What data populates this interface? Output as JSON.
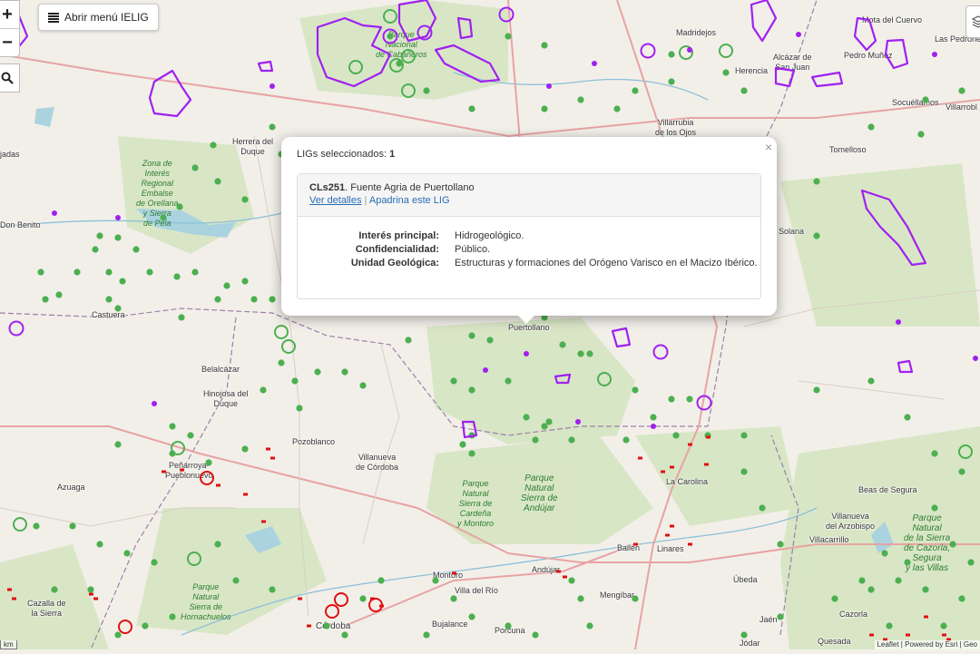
{
  "toolbar": {
    "zoom_in": "+",
    "zoom_out": "−",
    "menu_label": "Abrir menú IELIG"
  },
  "popup": {
    "selected_label": "LIGs seleccionados:",
    "selected_count": "1",
    "close": "×",
    "lig_code": "CLs251",
    "lig_name": ". Fuente Agria de Puertollano",
    "details_link": "Ver detalles",
    "separator": "|",
    "sponsor_link": "Apadrina este LIG",
    "fields": [
      {
        "label": "Interés principal:",
        "value": "Hidrogeológico."
      },
      {
        "label": "Confidencialidad:",
        "value": "Público."
      },
      {
        "label": "Unidad Geológica:",
        "value": "Estructuras y formaciones del Orógeno Varisco en el Macizo Ibérico."
      }
    ]
  },
  "places": [
    {
      "name": "Madridejos"
    },
    {
      "name": "Mota del Cuervo"
    },
    {
      "name": "Las Pedroñeras"
    },
    {
      "name": "Alcázar de\nSan Juan"
    },
    {
      "name": "Herencia"
    },
    {
      "name": "Pedro Muñoz"
    },
    {
      "name": "Socuéllamos"
    },
    {
      "name": "Villarrobl"
    },
    {
      "name": "Villarrubia\nde los Ojos"
    },
    {
      "name": "Tomelloso"
    },
    {
      "name": "Herrera del\nDuque"
    },
    {
      "name": "Don Benito"
    },
    {
      "name": "Castuera"
    },
    {
      "name": "Solana"
    },
    {
      "name": "Puertollano"
    },
    {
      "name": "Belalcázar"
    },
    {
      "name": "Hinojosa del\nDuque"
    },
    {
      "name": "Pozoblanco"
    },
    {
      "name": "Villanueva\nde Córdoba"
    },
    {
      "name": "Peñarroya-\nPueblonuevo"
    },
    {
      "name": "Azuaga"
    },
    {
      "name": "La Carolina"
    },
    {
      "name": "Beas de Segura"
    },
    {
      "name": "Villanueva\ndel Arzobispo"
    },
    {
      "name": "Villacarrillo"
    },
    {
      "name": "Bailén"
    },
    {
      "name": "Linares"
    },
    {
      "name": "Úbeda"
    },
    {
      "name": "Andújar"
    },
    {
      "name": "Montoro"
    },
    {
      "name": "Villa del Río"
    },
    {
      "name": "Mengíbar"
    },
    {
      "name": "Jaén"
    },
    {
      "name": "Cazalla de\nla Sierra"
    },
    {
      "name": "Córdoba"
    },
    {
      "name": "Bujalance"
    },
    {
      "name": "Porcuna"
    },
    {
      "name": "Cazorla"
    },
    {
      "name": "Quesada"
    },
    {
      "name": "Jódar"
    },
    {
      "name": "jadas"
    }
  ],
  "parks": [
    {
      "name": "Parque\nNacional\nde Cabañeros"
    },
    {
      "name": "Zona de\nInterés\nRegional\nEmbalse\nde Orellana\ny Sierra\nde Pela"
    },
    {
      "name": "Parque\nNatural\nSierra de\nAndújar"
    },
    {
      "name": "Parque\nNatural\nSierra de\nCardeña\ny Montoro"
    },
    {
      "name": "Parque\nNatural\nde la Sierra\nde Cazorla,\nSegura\ny las Villas"
    },
    {
      "name": "Parque\nNatural\nSierra de\nHornachuelos"
    }
  ],
  "attribution": "Leaflet | Powered by Esri | Geo",
  "scale_label": "km",
  "colors": {
    "point_green": "#4caf50",
    "polygon_purple": "#a020f0",
    "feature_red": "#e01010",
    "link_blue": "#2a6db5"
  }
}
